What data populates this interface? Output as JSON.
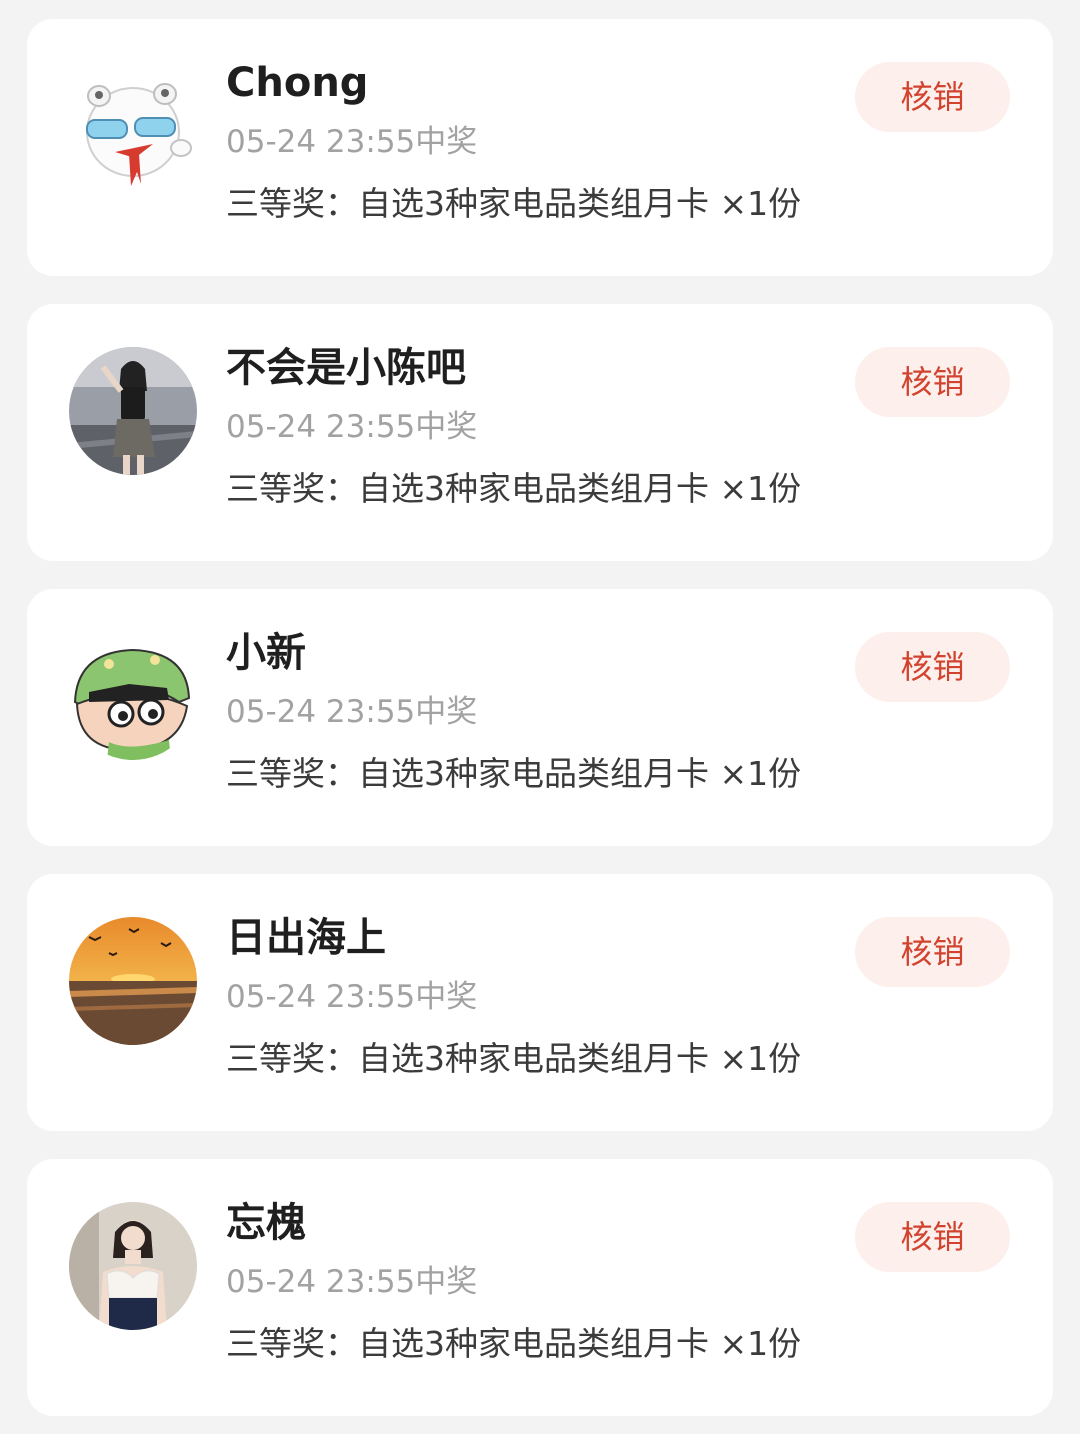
{
  "winners": [
    {
      "avatar_icon": "cartoon-bear-sunglasses-avatar",
      "name": "Chong",
      "time": "05-24 23:55中奖",
      "prize": "三等奖：自选3种家电品类组月卡 ×1份",
      "action_label": "核销"
    },
    {
      "avatar_icon": "girl-photo-avatar",
      "name": "不会是小陈吧",
      "time": "05-24 23:55中奖",
      "prize": "三等奖：自选3种家电品类组月卡 ×1份",
      "action_label": "核销"
    },
    {
      "avatar_icon": "crayon-shinchan-avatar",
      "name": "小新",
      "time": "05-24 23:55中奖",
      "prize": "三等奖：自选3种家电品类组月卡 ×1份",
      "action_label": "核销"
    },
    {
      "avatar_icon": "sunrise-sea-avatar",
      "name": "日出海上",
      "time": "05-24 23:55中奖",
      "prize": "三等奖：自选3种家电品类组月卡 ×1份",
      "action_label": "核销"
    },
    {
      "avatar_icon": "woman-photo-avatar",
      "name": "忘槐",
      "time": "05-24 23:55中奖",
      "prize": "三等奖：自选3种家电品类组月卡 ×1份",
      "action_label": "核销"
    }
  ],
  "colors": {
    "background": "#f3f3f3",
    "card": "#ffffff",
    "button_bg": "#fcefec",
    "button_text": "#d2432f",
    "time_text": "#a2a2a2"
  }
}
